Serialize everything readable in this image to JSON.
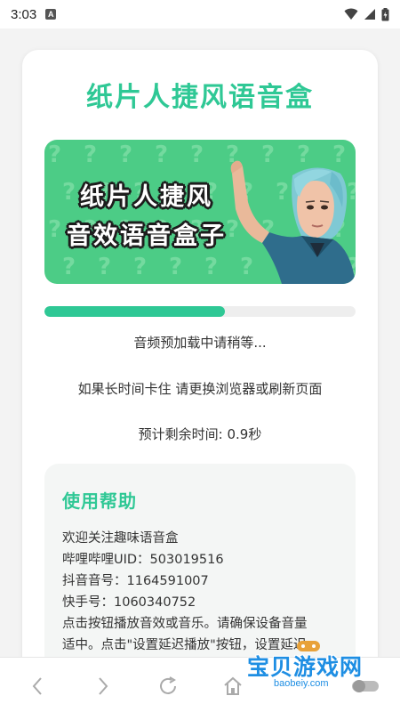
{
  "status_bar": {
    "time": "3:03",
    "notification_letter": "A"
  },
  "app": {
    "title": "纸片人捷风语音盒",
    "banner": {
      "line1": "纸片人捷风",
      "line2": "音效语音盒子"
    }
  },
  "loading": {
    "progress_percent": 58,
    "status_text": "音频预加载中请稍等...",
    "hint_text": "如果长时间卡住 请更换浏览器或刷新页面",
    "remaining_text": "预计剩余时间: 0.9秒"
  },
  "help": {
    "title": "使用帮助",
    "lines": [
      "欢迎关注趣味语音盒",
      "哔哩哔哩UID：503019516",
      "抖音音号：1164591007",
      "快手号：1060340752",
      "点击按钮播放音效或音乐。请确保设备音量",
      "适中。点击\"设置延迟播放\"按钮，设置延迟"
    ]
  },
  "nav": {
    "back_icon": "chevron-left-icon",
    "forward_icon": "chevron-right-icon",
    "reload_icon": "reload-icon",
    "home_icon": "home-icon"
  },
  "watermark": {
    "text": "宝贝游戏网",
    "url": "baobeiy.com"
  },
  "colors": {
    "accent": "#2fc895",
    "banner_green": "#4ccc86",
    "watermark_blue": "#1e8ee3"
  }
}
